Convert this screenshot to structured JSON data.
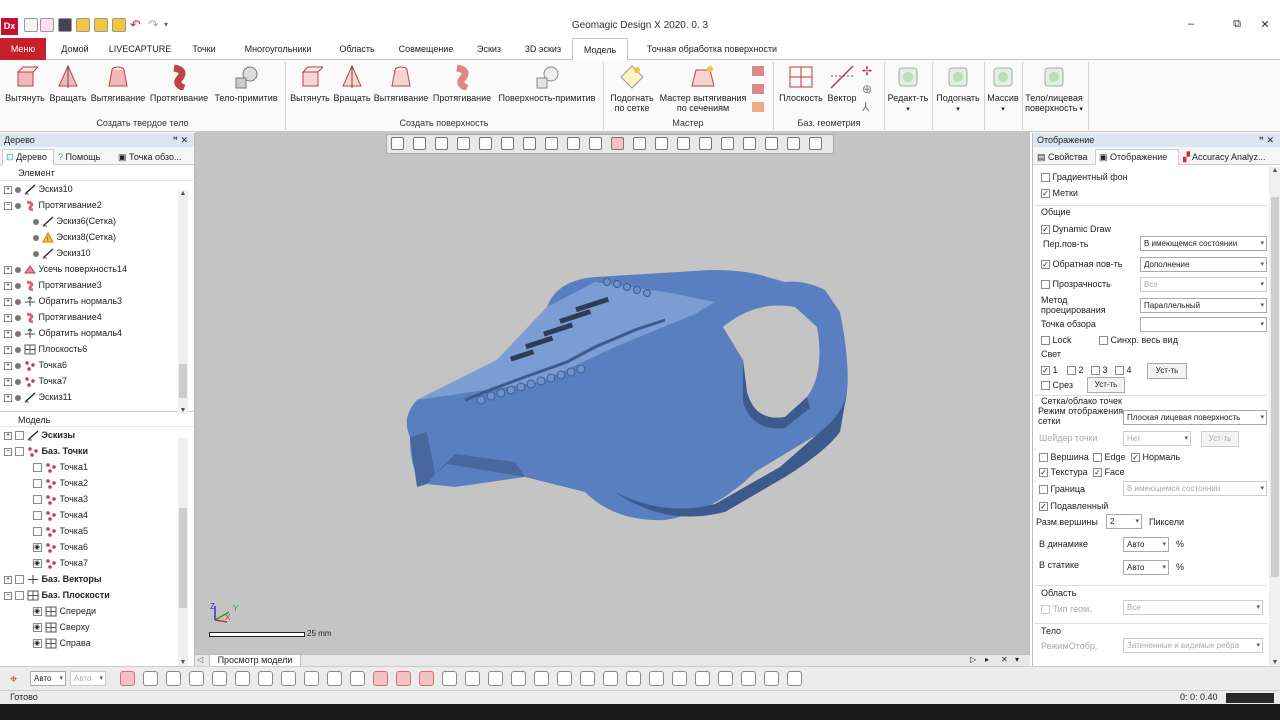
{
  "app": {
    "title": "Geomagic Design X 2020. 0. 3",
    "logo": "Dx"
  },
  "window_controls": [
    "–",
    "⧉",
    "✕"
  ],
  "ribbon_tabs": [
    {
      "label": "Меню"
    },
    {
      "label": "Домой"
    },
    {
      "label": "LIVECAPTURE"
    },
    {
      "label": "Точки"
    },
    {
      "label": "Многоугольники"
    },
    {
      "label": "Область"
    },
    {
      "label": "Совмещение"
    },
    {
      "label": "Эскиз"
    },
    {
      "label": "3D эскиз"
    },
    {
      "label": "Модель"
    },
    {
      "label": "Точная обработка поверхности"
    }
  ],
  "ribbon": {
    "solid": {
      "buttons": [
        "Вытянуть",
        "Вращать",
        "Вытягивание",
        "Протягивание",
        "Тело-примитив"
      ],
      "group": "Создать твердое тело"
    },
    "surface": {
      "buttons": [
        "Вытянуть",
        "Вращать",
        "Вытягивание",
        "Протягивание",
        "Поверхность-примитив"
      ],
      "group": "Создать поверхность"
    },
    "wizard": {
      "btn1_line1": "Подогнать",
      "btn1_line2": "по сетке",
      "btn2_line1": "Мастер вытягивания",
      "btn2_line2": "по сечениям",
      "group": "Мастер"
    },
    "refgeom": {
      "buttons": [
        "Плоскость",
        "Вектор"
      ],
      "group": "Баз. геометрия"
    },
    "edit": {
      "redact": "Редакт-ть",
      "fit": "Подогнать",
      "array": "Массив",
      "body_line1": "Тело/лицевая",
      "body_line2": "поверхность"
    }
  },
  "tree_panel": {
    "title": "Дерево",
    "pin": "ꟸ ✕",
    "tabs": [
      "Дерево",
      "Помощь",
      "Точка обзо..."
    ],
    "element_header": "Элемент",
    "features": [
      {
        "label": "Эскиз10",
        "icon": "sketch-icon",
        "indent": 0,
        "expand": "+"
      },
      {
        "label": "Протягивание2",
        "icon": "sweep-icon",
        "indent": 0,
        "expand": "−"
      },
      {
        "label": "Эскиз6(Сетка)",
        "icon": "sketch-icon",
        "indent": 1,
        "expand": ""
      },
      {
        "label": "Эскиз8(Сетка)",
        "icon": "sketch-warning-icon",
        "indent": 1,
        "expand": ""
      },
      {
        "label": "Эскиз10",
        "icon": "sketch-icon",
        "indent": 1,
        "expand": ""
      },
      {
        "label": "Усечь поверхность14",
        "icon": "trim-icon",
        "indent": 0,
        "expand": "+"
      },
      {
        "label": "Протягивание3",
        "icon": "sweep-icon",
        "indent": 0,
        "expand": "+"
      },
      {
        "label": "Обратить нормаль3",
        "icon": "normal-icon",
        "indent": 0,
        "expand": "+"
      },
      {
        "label": "Протягивание4",
        "icon": "sweep-icon",
        "indent": 0,
        "expand": "+"
      },
      {
        "label": "Обратить нормаль4",
        "icon": "normal-icon",
        "indent": 0,
        "expand": "+"
      },
      {
        "label": "Плоскость6",
        "icon": "plane-icon",
        "indent": 0,
        "expand": "+"
      },
      {
        "label": "Точка6",
        "icon": "point-icon",
        "indent": 0,
        "expand": "+"
      },
      {
        "label": "Точка7",
        "icon": "point-icon",
        "indent": 0,
        "expand": "+"
      },
      {
        "label": "Эскиз11",
        "icon": "sketch-icon",
        "indent": 0,
        "expand": "+"
      }
    ],
    "model_header": "Модель",
    "model": [
      {
        "label": "Эскизы",
        "icon": "sketch-icon",
        "indent": 0,
        "expand": "+",
        "bold": true,
        "eye": false
      },
      {
        "label": "Баз. Точки",
        "icon": "point-icon",
        "indent": 0,
        "expand": "−",
        "bold": true,
        "eye": false
      },
      {
        "label": "Точка1",
        "icon": "point-icon",
        "indent": 1,
        "expand": "",
        "bold": false,
        "eye": false
      },
      {
        "label": "Точка2",
        "icon": "point-icon",
        "indent": 1,
        "expand": "",
        "bold": false,
        "eye": false
      },
      {
        "label": "Точка3",
        "icon": "point-icon",
        "indent": 1,
        "expand": "",
        "bold": false,
        "eye": false
      },
      {
        "label": "Точка4",
        "icon": "point-icon",
        "indent": 1,
        "expand": "",
        "bold": false,
        "eye": false
      },
      {
        "label": "Точка5",
        "icon": "point-icon",
        "indent": 1,
        "expand": "",
        "bold": false,
        "eye": false
      },
      {
        "label": "Точка6",
        "icon": "point-icon",
        "indent": 1,
        "expand": "",
        "bold": false,
        "eye": true
      },
      {
        "label": "Точка7",
        "icon": "point-icon",
        "indent": 1,
        "expand": "",
        "bold": false,
        "eye": true
      },
      {
        "label": "Баз. Векторы",
        "icon": "vector-icon",
        "indent": 0,
        "expand": "+",
        "bold": true,
        "eye": false
      },
      {
        "label": "Баз. Плоскости",
        "icon": "plane-icon",
        "indent": 0,
        "expand": "−",
        "bold": true,
        "eye": false
      },
      {
        "label": "Спереди",
        "icon": "plane-icon",
        "indent": 1,
        "expand": "",
        "bold": false,
        "eye": true
      },
      {
        "label": "Сверху",
        "icon": "plane-icon",
        "indent": 1,
        "expand": "",
        "bold": false,
        "eye": true
      },
      {
        "label": "Справа",
        "icon": "plane-icon",
        "indent": 1,
        "expand": "",
        "bold": false,
        "eye": true
      }
    ]
  },
  "viewport": {
    "scale_label": "25 mm",
    "axes": {
      "x": "X",
      "y": "Y",
      "z": "Z"
    },
    "tab": "Просмотр модели",
    "model_color": "#5a7fc0",
    "background": "#c4c4c4"
  },
  "display_panel": {
    "title": "Отображение",
    "pin": "ꟸ ✕",
    "tabs": [
      "Свойства",
      "Отображение",
      "Accuracy Analyz..."
    ],
    "gradient_bg": "Градиентный фон",
    "labels": "Метки",
    "general": "Общие",
    "dynamic_draw": "Dynamic Draw",
    "front_face_label": "Пер.пов-ть",
    "front_face_value": "В имеющемся состоянии",
    "back_face_label": "Обратная пов-ть",
    "back_face_value": "Дополнение",
    "transparency_label": "Прозрачность",
    "transparency_value": "Все",
    "projection_label_1": "Метод",
    "projection_label_2": "проецирования",
    "projection_value": "Параллельный",
    "viewpoint_label": "Точка обзора",
    "viewpoint_value": "",
    "lock": "Lock",
    "sync": "Синхр. весь вид",
    "light": "Свет",
    "lights": [
      "1",
      "2",
      "3",
      "4"
    ],
    "set_button": "Уст-ть",
    "section": "Срез",
    "mesh_header": "Сетка/облако точек",
    "mesh_mode_label_1": "Режим отображения",
    "mesh_mode_label_2": "сетки",
    "mesh_mode_value": "Плоская лицевая поверхность",
    "point_shader_label": "Шейдер точки",
    "point_shader_value": "Нет",
    "vertex": "Вершина",
    "edge": "Edge",
    "normal": "Нормаль",
    "texture": "Текстура",
    "face": "Face",
    "boundary": "Граница",
    "boundary_value": "В имеющемся состоянии",
    "suppressed": "Подавленный",
    "vertex_size_label": "Разм.вершины",
    "vertex_size_value": "2",
    "pixels": "Пиксели",
    "dynamic_label": "В динамике",
    "dynamic_value": "Авто",
    "static_label": "В статике",
    "static_value": "Авто",
    "percent": "%",
    "region_header": "Область",
    "geom_type_label": "Тип геом.",
    "geom_type_value": "Все",
    "body_header": "Тело",
    "body_mode_label": "РежимОтобр.",
    "body_mode_value": "Затененные и видимые ребра"
  },
  "bottom_toolbar": {
    "auto1": "Авто",
    "auto2": "Авто"
  },
  "status": {
    "text": "Готово",
    "time": "0: 0: 0.40"
  }
}
